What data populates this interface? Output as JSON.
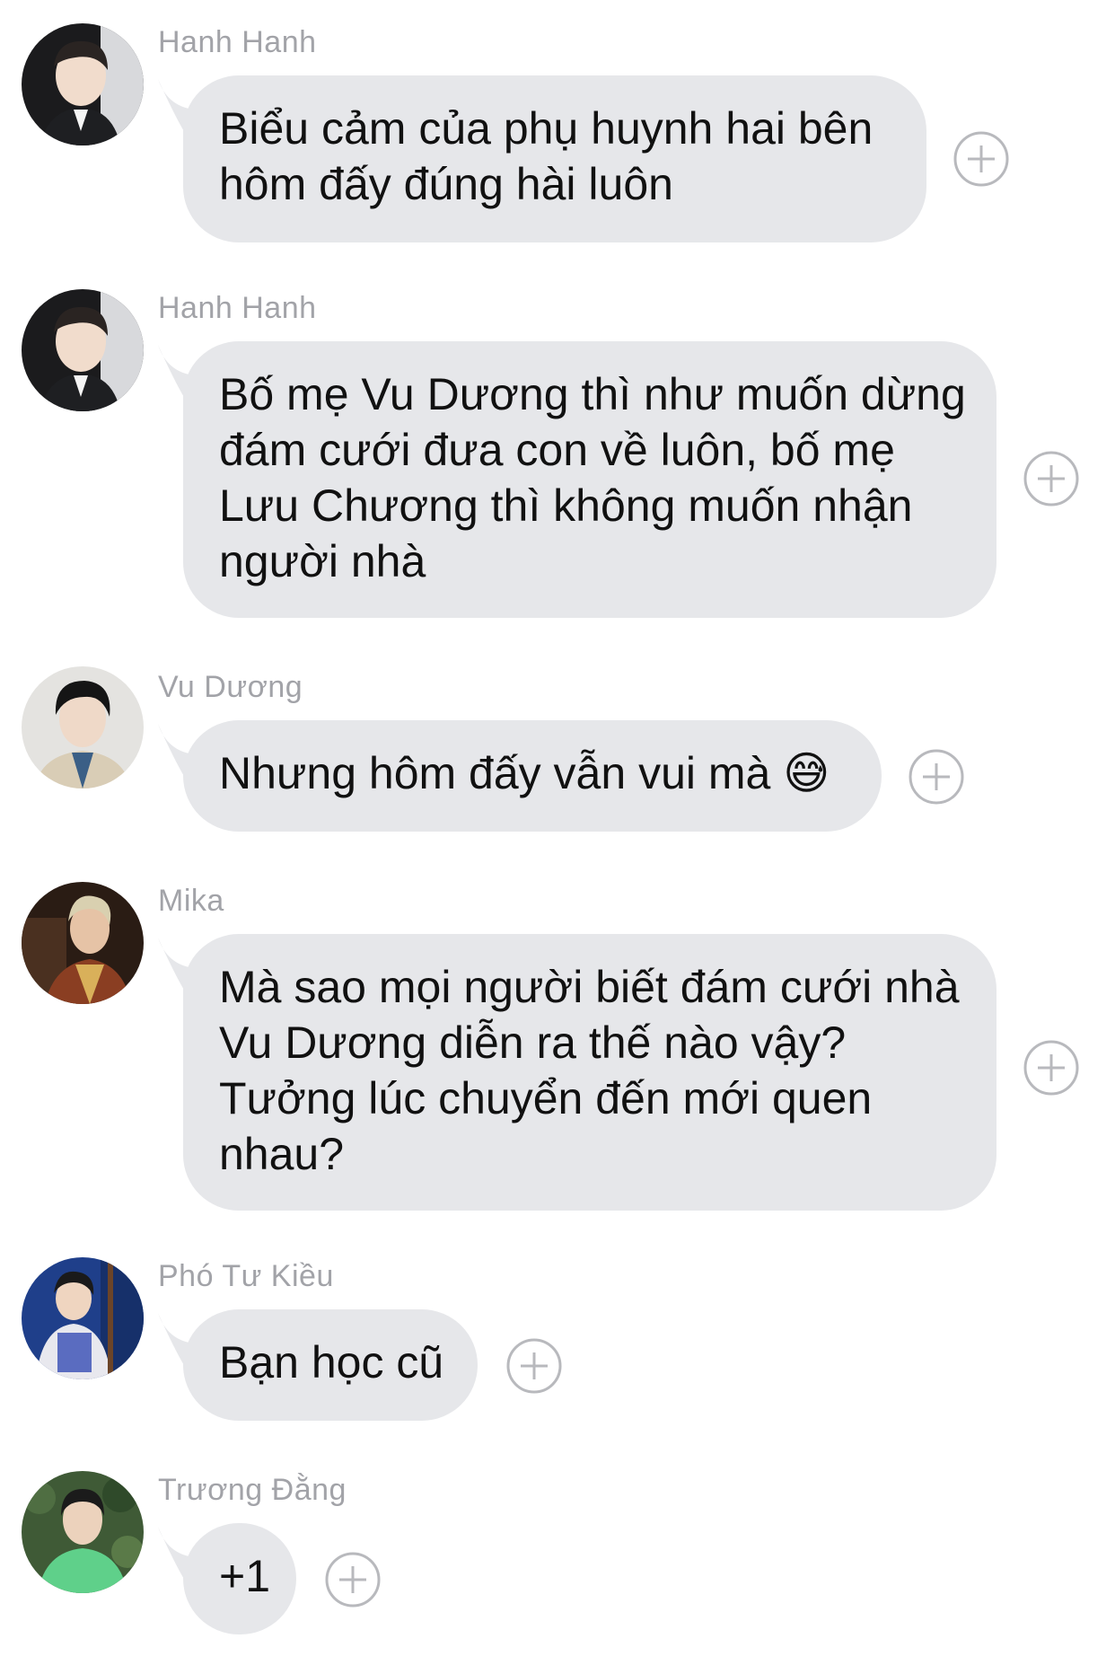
{
  "messages": [
    {
      "sender": "Hanh Hanh",
      "avatar": "avatar-hanh-hanh",
      "lines": [
        "Biểu cảm của phụ huynh hai bên",
        "hôm đấy đúng hài luôn"
      ]
    },
    {
      "sender": "Hanh Hanh",
      "avatar": "avatar-hanh-hanh",
      "lines": [
        "Bố mẹ Vu Dương thì như muốn dừng",
        "đám cưới đưa con về luôn, bố mẹ",
        "Lưu Chương thì không muốn nhận",
        "người nhà"
      ]
    },
    {
      "sender": "Vu Dương",
      "avatar": "avatar-vu-duong",
      "lines": [
        "Nhưng hôm đấy vẫn vui mà 😅"
      ]
    },
    {
      "sender": "Mika",
      "avatar": "avatar-mika",
      "lines": [
        "Mà sao mọi người biết đám cưới nhà",
        "Vu Dương diễn ra thế nào vậy?",
        "Tưởng lúc chuyển đến mới quen",
        "nhau?"
      ]
    },
    {
      "sender": "Phó Tư Kiều",
      "avatar": "avatar-pho-tu-kieu",
      "lines": [
        "Bạn học cũ"
      ]
    },
    {
      "sender": "Trương Đằng",
      "avatar": "avatar-truong-dang",
      "lines": [
        "+1"
      ]
    }
  ],
  "colors": {
    "bubble": "#e6e7ea",
    "sender_text": "#a2a3a8",
    "message_text": "#111111",
    "plus_icon": "#b8b9bd"
  }
}
